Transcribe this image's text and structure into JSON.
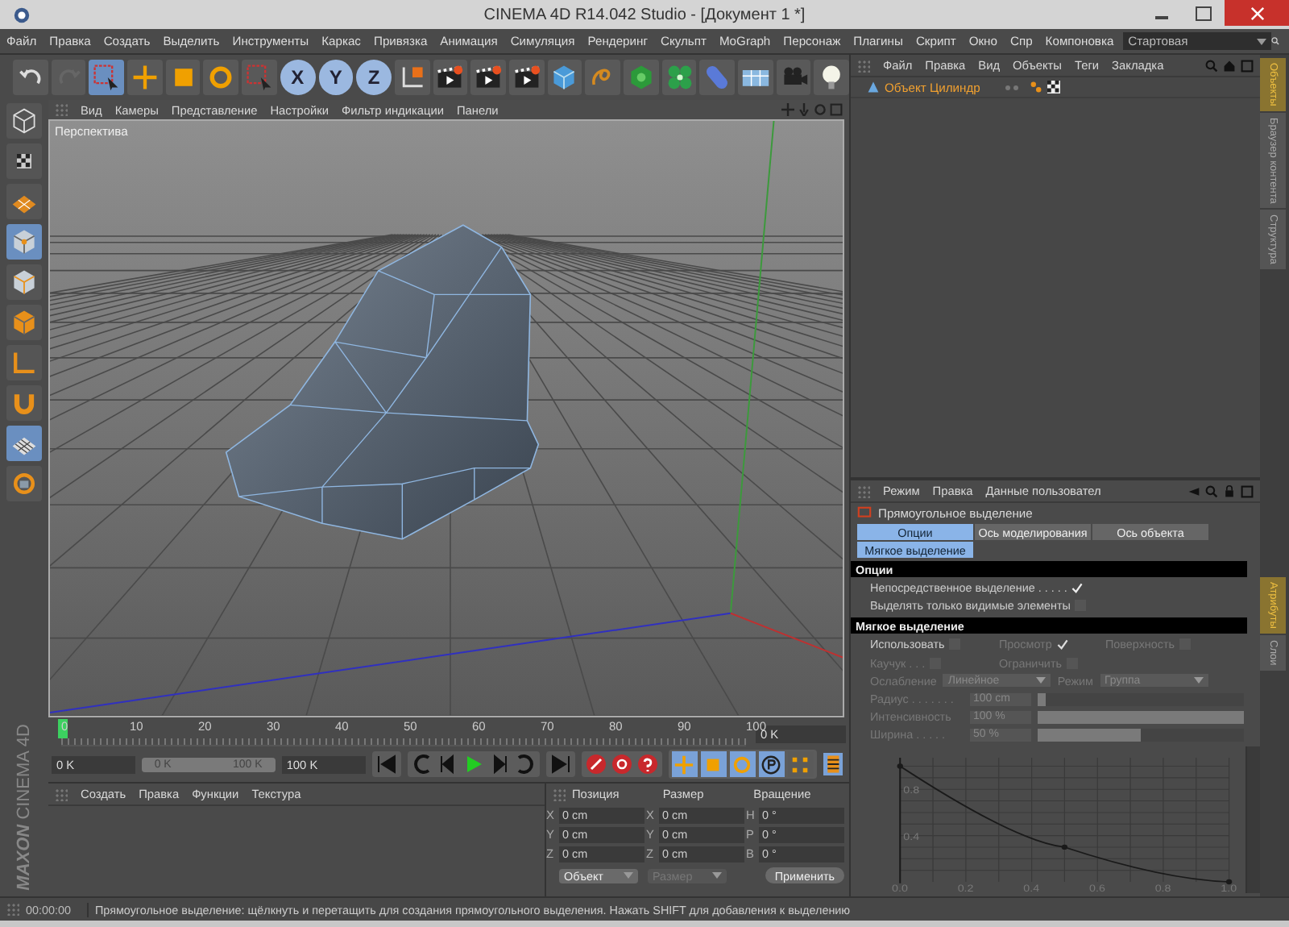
{
  "window": {
    "title": "CINEMA 4D R14.042 Studio - [Документ 1 *]"
  },
  "menu": [
    "Файл",
    "Правка",
    "Создать",
    "Выделить",
    "Инструменты",
    "Каркас",
    "Привязка",
    "Анимация",
    "Симуляция",
    "Рендеринг",
    "Скульпт",
    "MoGraph",
    "Персонаж",
    "Плагины",
    "Скрипт",
    "Окно",
    "Спр"
  ],
  "layout": {
    "label": "Компоновка",
    "value": "Стартовая"
  },
  "toolbar": [
    {
      "kind": "undo",
      "selected": false
    },
    {
      "kind": "redo",
      "selected": false
    },
    {
      "kind": "select",
      "selected": true
    },
    {
      "kind": "move",
      "selected": false
    },
    {
      "kind": "scale",
      "selected": false
    },
    {
      "kind": "rotate",
      "selected": false
    },
    {
      "kind": "select",
      "selected": false
    },
    {
      "kind": "axis",
      "label": "X",
      "selected": true
    },
    {
      "kind": "axis",
      "label": "Y",
      "selected": true
    },
    {
      "kind": "axis",
      "label": "Z",
      "selected": true
    },
    {
      "kind": "coord",
      "selected": false
    },
    {
      "kind": "render",
      "selected": false
    },
    {
      "kind": "render",
      "selected": false
    },
    {
      "kind": "render",
      "selected": false
    },
    {
      "kind": "cube",
      "selected": false
    },
    {
      "kind": "spline",
      "selected": false
    },
    {
      "kind": "subdivision",
      "selected": false
    },
    {
      "kind": "flower",
      "selected": false
    },
    {
      "kind": "capsule",
      "selected": false
    },
    {
      "kind": "floor",
      "selected": false
    },
    {
      "kind": "camera",
      "selected": false
    },
    {
      "kind": "light",
      "selected": false
    }
  ],
  "viewport": {
    "menu": [
      "Вид",
      "Камеры",
      "Представление",
      "Настройки",
      "Фильтр индикации",
      "Панели"
    ],
    "label": "Перспектива"
  },
  "left_tools": [
    {
      "kind": "model",
      "selected": false
    },
    {
      "kind": "texture",
      "selected": false
    },
    {
      "kind": "workplane",
      "selected": false
    },
    {
      "kind": "points",
      "selected": true
    },
    {
      "kind": "edges",
      "selected": false
    },
    {
      "kind": "polygons",
      "selected": false
    },
    {
      "kind": "axis",
      "selected": false
    },
    {
      "kind": "magnet",
      "selected": false
    },
    {
      "kind": "snap",
      "selected": true
    },
    {
      "kind": "lock",
      "selected": false
    }
  ],
  "timeline": {
    "ticks": [
      "0",
      "10",
      "20",
      "30",
      "40",
      "50",
      "60",
      "70",
      "80",
      "90",
      "100"
    ],
    "level": 0,
    "current": "0 K",
    "start": "0 K",
    "range": {
      "start": "0 K",
      "end": "100 K",
      "level": 1
    },
    "end": "100 K"
  },
  "key_buttons": [
    {
      "kind": "position",
      "selected": true
    },
    {
      "kind": "scale",
      "selected": true
    },
    {
      "kind": "rotation",
      "selected": true
    },
    {
      "kind": "parameter",
      "selected": true
    },
    {
      "kind": "points",
      "selected": false
    }
  ],
  "materials": {
    "menu": [
      "Создать",
      "Правка",
      "Функции",
      "Текстура"
    ]
  },
  "logo": {
    "brand": "MAXON",
    "product": "CINEMA 4D"
  },
  "coordinates": {
    "headers": [
      "Позиция",
      "Размер",
      "Вращение"
    ],
    "rows": [
      {
        "labels": [
          "X",
          "X",
          "H"
        ],
        "values": [
          "0 cm",
          "0 cm",
          "0 °"
        ]
      },
      {
        "labels": [
          "Y",
          "Y",
          "P"
        ],
        "values": [
          "0 cm",
          "0 cm",
          "0 °"
        ]
      },
      {
        "labels": [
          "Z",
          "Z",
          "B"
        ],
        "values": [
          "0 cm",
          "0 cm",
          "0 °"
        ]
      }
    ],
    "dropdowns": [
      {
        "value": "Объект",
        "disabled": false
      },
      {
        "value": "Размер",
        "disabled": true
      }
    ],
    "apply": "Применить"
  },
  "status_bar": {
    "time": "00:00:00",
    "message": "Прямоугольное выделение: щёлкнуть и перетащить для создания прямоугольного выделения. Нажать SHIFT для добавления к выделению"
  },
  "object_manager": {
    "menu": [
      "Файл",
      "Правка",
      "Вид",
      "Объекты",
      "Теги",
      "Закладка"
    ],
    "objects": [
      {
        "name": "Объект Цилиндр",
        "selected": true
      }
    ]
  },
  "attributes": {
    "menu": [
      "Режим",
      "Правка",
      "Данные пользовател"
    ],
    "title": "Прямоугольное выделение",
    "tabs": [
      {
        "label": "Опции",
        "selected": true
      },
      {
        "label": "Ось моделирования",
        "selected": false
      },
      {
        "label": "Ось объекта",
        "selected": false
      },
      {
        "label": "Мягкое выделение",
        "selected": true
      }
    ],
    "options_header": "Опции",
    "options": [
      {
        "label": "Непосредственное выделение . . . . .",
        "checked": true
      },
      {
        "label": "Выделять только видимые элементы",
        "checked": false
      }
    ],
    "soft_header": "Мягкое выделение",
    "soft_checks": [
      {
        "label": "Использовать",
        "checked": false,
        "disabled": false
      },
      {
        "label": "Просмотр",
        "checked": true,
        "disabled": true
      },
      {
        "label": "Поверхность",
        "checked": false,
        "disabled": true
      },
      {
        "label": "Каучук . . .",
        "checked": false,
        "disabled": true
      },
      {
        "label": "Ограничить",
        "checked": false,
        "disabled": true
      }
    ],
    "falloff": {
      "label": "Ослабление",
      "value": "Линейное"
    },
    "mode": {
      "label": "Режим",
      "value": "Группа"
    },
    "sliders": [
      {
        "label": "Радиус . . . . . . .",
        "value": "100 cm",
        "level": 0.03
      },
      {
        "label": "Интенсивность",
        "value": "100 %",
        "level": 1
      },
      {
        "label": "Ширина . . . . .",
        "value": "50 %",
        "level": 0.5
      }
    ],
    "chart_data": {
      "type": "line",
      "x": [
        0,
        0.5,
        1
      ],
      "grid": true,
      "series": [
        {
          "color": "#1a1a1a",
          "marker": true,
          "values": [
            1,
            0.3,
            0
          ]
        }
      ],
      "xlim": [
        0,
        1
      ],
      "ylim": [
        0,
        1
      ],
      "xticks": [
        {
          "value": 0,
          "label": "0.0"
        },
        {
          "value": 0.2,
          "label": "0.2"
        },
        {
          "value": 0.4,
          "label": "0.4"
        },
        {
          "value": 0.6,
          "label": "0.6"
        },
        {
          "value": 0.8,
          "label": "0.8"
        },
        {
          "value": 1,
          "label": "1.0"
        }
      ],
      "yticks": [
        {
          "value": 0.4,
          "label": "0.4"
        },
        {
          "value": 0.8,
          "label": "0.8"
        }
      ]
    }
  },
  "side_tabs_top": [
    {
      "label": "Объекты",
      "selected": true
    },
    {
      "label": "Браузер контента",
      "selected": false
    },
    {
      "label": "Структура",
      "selected": false
    }
  ],
  "side_tabs_bottom": [
    {
      "label": "Атрибуты",
      "selected": true
    },
    {
      "label": "Слои",
      "selected": false
    }
  ]
}
